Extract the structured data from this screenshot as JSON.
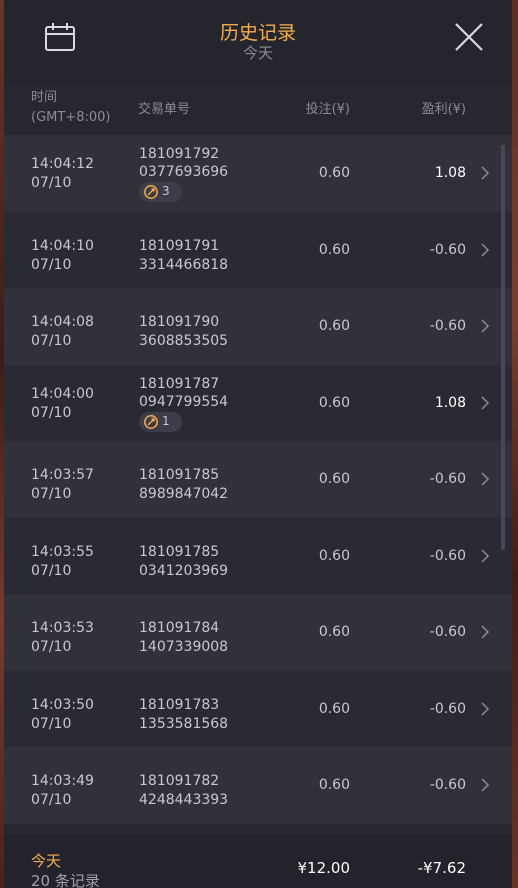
{
  "header": {
    "title": "历史记录",
    "subtitle": "今天"
  },
  "columns": {
    "time_line1": "时间",
    "time_line2": "(GMT+8:00)",
    "order": "交易单号",
    "bet": "投注(¥)",
    "profit": "盈利(¥)"
  },
  "rows": [
    {
      "time": "14:04:12",
      "date": "07/10",
      "order1": "181091792",
      "order2": "0377693696",
      "bet": "0.60",
      "profit": "1.08",
      "badge": "3"
    },
    {
      "time": "14:04:10",
      "date": "07/10",
      "order1": "181091791",
      "order2": "3314466818",
      "bet": "0.60",
      "profit": "-0.60"
    },
    {
      "time": "14:04:08",
      "date": "07/10",
      "order1": "181091790",
      "order2": "3608853505",
      "bet": "0.60",
      "profit": "-0.60"
    },
    {
      "time": "14:04:00",
      "date": "07/10",
      "order1": "181091787",
      "order2": "0947799554",
      "bet": "0.60",
      "profit": "1.08",
      "badge": "1"
    },
    {
      "time": "14:03:57",
      "date": "07/10",
      "order1": "181091785",
      "order2": "8989847042",
      "bet": "0.60",
      "profit": "-0.60"
    },
    {
      "time": "14:03:55",
      "date": "07/10",
      "order1": "181091785",
      "order2": "0341203969",
      "bet": "0.60",
      "profit": "-0.60"
    },
    {
      "time": "14:03:53",
      "date": "07/10",
      "order1": "181091784",
      "order2": "1407339008",
      "bet": "0.60",
      "profit": "-0.60"
    },
    {
      "time": "14:03:50",
      "date": "07/10",
      "order1": "181091783",
      "order2": "1353581568",
      "bet": "0.60",
      "profit": "-0.60"
    },
    {
      "time": "14:03:49",
      "date": "07/10",
      "order1": "181091782",
      "order2": "4248443393",
      "bet": "0.60",
      "profit": "-0.60"
    }
  ],
  "footer": {
    "label": "今天",
    "count": "20 条记录",
    "total_bet": "¥12.00",
    "total_profit": "-¥7.62"
  },
  "colors": {
    "accent": "#f6ae4a",
    "panel": "#26272f",
    "row_odd": "#30313b",
    "row_even": "#292a33"
  },
  "icons": {
    "calendar": "calendar-icon",
    "close": "close-icon",
    "chevron": "chevron-right-icon",
    "feature": "free-spin-icon"
  }
}
